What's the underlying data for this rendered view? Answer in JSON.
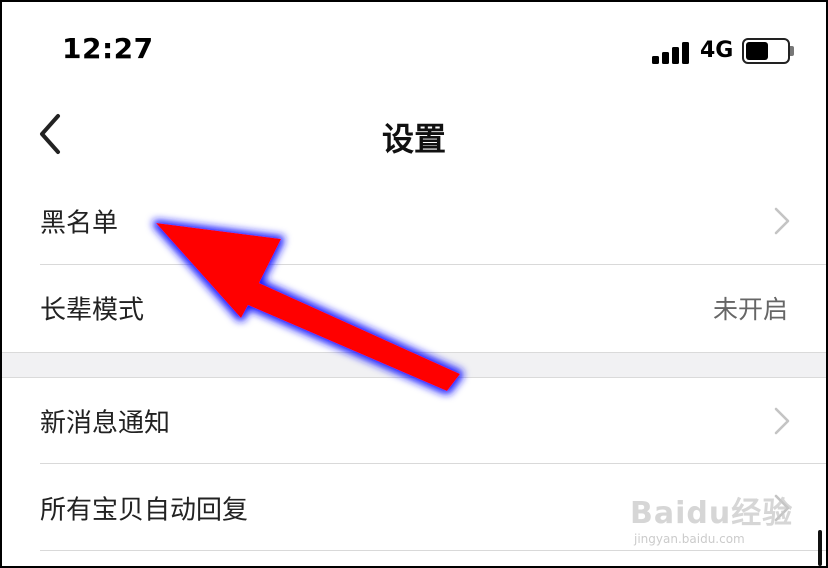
{
  "status_bar": {
    "time": "12:27",
    "network": "4G",
    "battery_level": 0.55
  },
  "header": {
    "title": "设置",
    "back_icon": "chevron-left-icon"
  },
  "settings": {
    "items": [
      {
        "label": "黑名单",
        "value": "",
        "accessory": "chevron-right-icon"
      },
      {
        "label": "长辈模式",
        "value": "未开启",
        "accessory": ""
      },
      {
        "label": "新消息通知",
        "value": "",
        "accessory": "chevron-right-icon"
      },
      {
        "label": "所有宝贝自动回复",
        "value": "",
        "accessory": "chevron-right-icon"
      }
    ]
  },
  "annotation": {
    "arrow_color": "#ff0000",
    "glow_color": "#1a1aff"
  },
  "watermark": {
    "text": "Baidu经验",
    "subtext": "jingyan.baidu.com"
  }
}
